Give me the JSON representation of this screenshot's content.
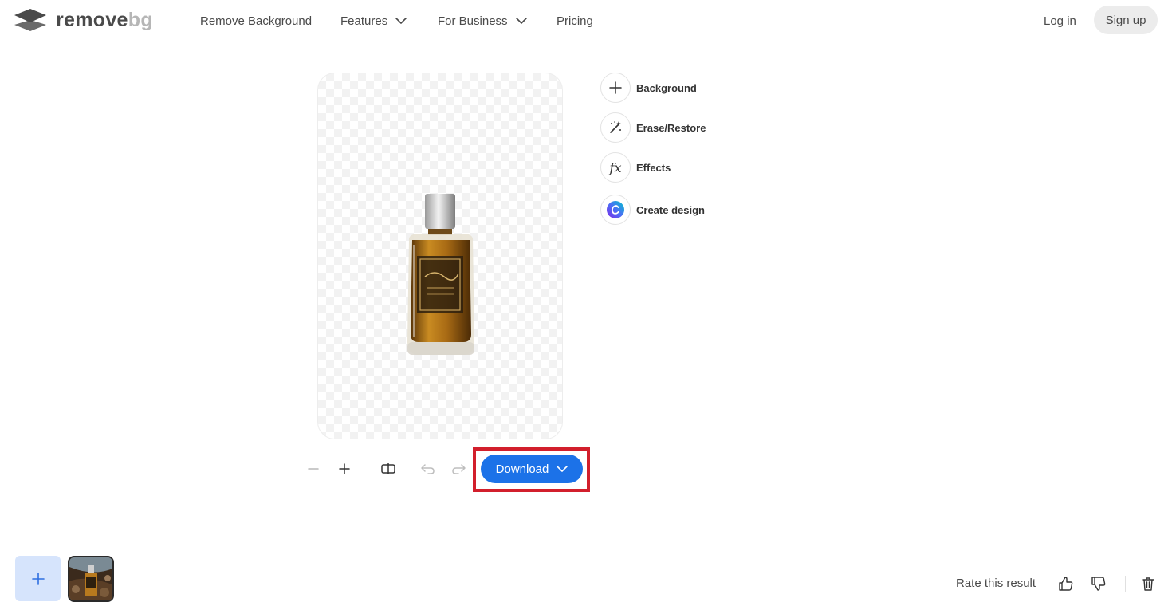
{
  "logo": {
    "word1": "remove",
    "word2": "bg"
  },
  "nav": {
    "remove_background": "Remove Background",
    "features": "Features",
    "for_business": "For Business",
    "pricing": "Pricing"
  },
  "auth": {
    "login": "Log in",
    "signup": "Sign up"
  },
  "tools": {
    "background": "Background",
    "erase_restore": "Erase/Restore",
    "effects": "Effects",
    "effects_icon_text": "fx",
    "create_design": "Create design"
  },
  "toolbar": {
    "download": "Download"
  },
  "footer": {
    "rate": "Rate this result"
  },
  "colors": {
    "primary_button": "#1c72e8",
    "highlight_border": "#d21f2c",
    "upload_tile": "#d6e4fc",
    "signup_bg": "#ececec"
  },
  "icons": {
    "logo": "removebg-logo-icon",
    "chevron": "chevron-down-icon",
    "plus": "plus-icon",
    "magic_wand": "magic-wand-icon",
    "canva": "canva-icon",
    "minus": "minus-icon",
    "compare": "compare-icon",
    "undo": "undo-icon",
    "redo": "redo-icon",
    "thumbs_up": "thumbs-up-icon",
    "thumbs_down": "thumbs-down-icon",
    "trash": "trash-icon"
  }
}
